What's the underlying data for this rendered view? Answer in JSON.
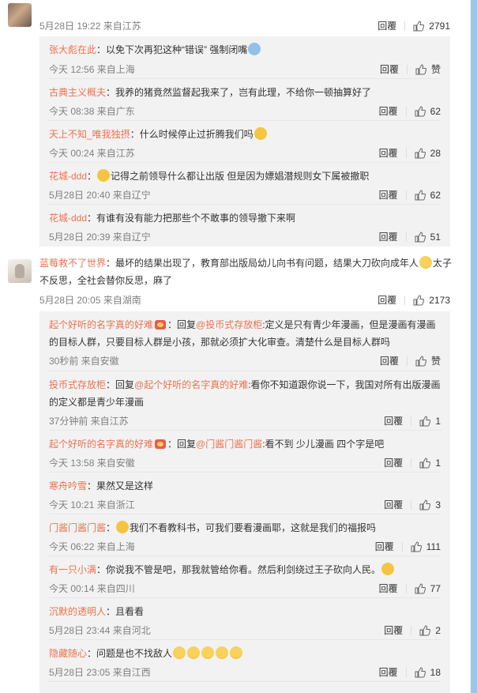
{
  "c1": {
    "meta": "5月28日 19:22 来自江苏",
    "like": "2791"
  },
  "c1subs": [
    {
      "user": "张大彪在此",
      "text": "：以免下次再犯这种“错误” 强制闭嘴",
      "meta": "今天 12:56 来自上海",
      "like": "赞"
    },
    {
      "user": "古典主义概夫",
      "text": "：我养的猪竟然监督起我来了，岂有此理，不给你一顿抽算好了",
      "meta": "今天 08:38 来自广东",
      "like": "62"
    },
    {
      "user": "天上不知_唯我独摂",
      "text": "：什么时候停止过折腾我们吗",
      "meta": "今天 00:24 来自江苏",
      "like": "28"
    },
    {
      "user": "花城-ddd",
      "text": "记得之前领导什么都让出版 但是因为嫖娼潜规则女下属被撤职",
      "meta": "5月28日 20:40 来自辽宁",
      "like": "62"
    },
    {
      "user": "花城-ddd",
      "text": "：有谁有没有能力把那些个不敢事的领导撤下来啊",
      "meta": "5月28日 20:39 来自辽宁",
      "like": "51"
    }
  ],
  "c2": {
    "user": "蓝莓救不了世界",
    "text1": "：最坏的结果出现了，教育部出版局幼儿向书有问题，结果大刀砍向成年人",
    "text2": "太子不反思，全社会替你反思，麻了",
    "meta": "5月28日 20:05 来自湖南",
    "like": "2173"
  },
  "c2subs": [
    {
      "user": "起个好听的名字真的好难",
      "pre": "：回复",
      "ref": "@投币式存放柜",
      "text": ":定义是只有青少年漫画，但是漫画有漫画的目标人群，只要目标人群是小孩，那就必须扩大化审查。清楚什么是目标人群吗",
      "meta": "30秒前 来自安徽",
      "like": "赞"
    },
    {
      "user": "投币式存放柜",
      "pre": "：回复",
      "ref": "@起个好听的名字真的好难",
      "text": ":看你不知道跟你说一下，我国对所有出版漫画的定义都是青少年漫画",
      "meta": "37分钟前 来自江苏",
      "like": "1"
    },
    {
      "user": "起个好听的名字真的好难",
      "pre": "：回复",
      "ref": "@门酱门酱门酱",
      "text": ":看不到 少儿漫画 四个字是吧",
      "meta": "今天 13:58 来自安徽",
      "like": "1"
    },
    {
      "user": "寒舟吟雪",
      "text": "：果然又是这样",
      "meta": "今天 10:21 来自浙江",
      "like": "3"
    },
    {
      "user": "门酱门酱门酱",
      "text": "我们不看教科书，可我们要看漫画耶，这就是我们的福报吗",
      "meta": "今天 06:22 来自上海",
      "like": "111"
    },
    {
      "user": "有一只小满",
      "text": "：你说我不管是吧，那我就管给你看。然后利剑绕过王子砍向人民。",
      "meta": "今天 00:14 来自四川",
      "like": "77"
    },
    {
      "user": "沉默的透明人",
      "text": "：且看看",
      "meta": "5月28日 23:44 来自河北",
      "like": "2"
    },
    {
      "user": "隐藏随心",
      "text": "：问题是也不找敌人",
      "meta": "5月28日 23:05 来自江西",
      "like": "18"
    }
  ],
  "labels": {
    "reply": "回覆"
  }
}
